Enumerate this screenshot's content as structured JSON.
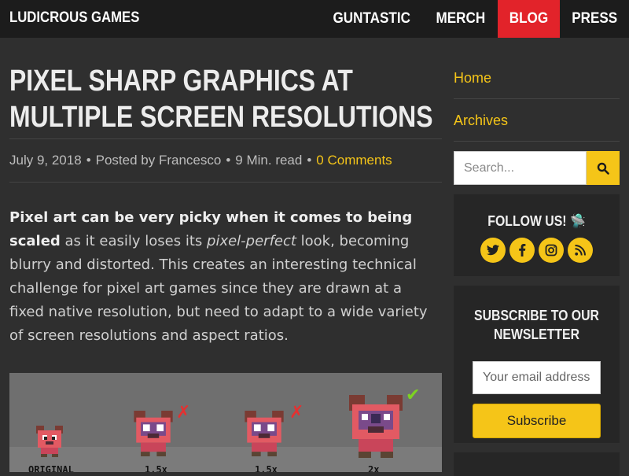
{
  "header": {
    "brand": "LUDICROUS GAMES",
    "nav": [
      "GUNTASTIC",
      "MERCH",
      "BLOG",
      "PRESS"
    ],
    "active_nav": "BLOG"
  },
  "article": {
    "title_line1": "PIXEL SHARP GRAPHICS AT",
    "title_line2": "MULTIPLE SCREEN RESOLUTIONS",
    "date": "July 9, 2018",
    "author": "Posted by Francesco",
    "read_time": "9 Min. read",
    "comments": "0 Comments",
    "lead_bold": "Pixel art can be very picky when it comes to being scaled",
    "lead_1": " as it easily loses its ",
    "lead_italic": "pixel-perfect",
    "lead_2": " look, becoming blurry and distorted. This creates an interesting technical challenge for pixel art games since they are drawn at a fixed native resolution, but need to adapt to a wide variety of screen resolutions and aspect ratios.",
    "figure_labels": [
      "ORIGINAL",
      "1.5x",
      "1.5x",
      "2x"
    ]
  },
  "sidebar": {
    "links": [
      "Home",
      "Archives"
    ],
    "search_placeholder": "Search...",
    "follow_title": "FOLLOW US! 🛸",
    "social_icons": [
      "twitter-icon",
      "facebook-icon",
      "instagram-icon",
      "rss-icon"
    ],
    "newsletter_title_1": "SUBSCRIBE TO OUR",
    "newsletter_title_2": "NEWSLETTER",
    "email_placeholder": "Your email address",
    "subscribe_label": "Subscribe"
  },
  "colors": {
    "accent": "#f5c518",
    "active_nav": "#e2232a",
    "background": "#2f2f2f",
    "header": "#1c1c1c"
  }
}
